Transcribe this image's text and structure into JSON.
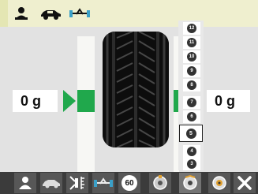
{
  "top_bar": {
    "icons": [
      "person-icon",
      "car-icon",
      "axle-icon"
    ]
  },
  "weights": {
    "left": "0 g",
    "right": "0 g"
  },
  "position_selector": {
    "items": [
      "12",
      "11",
      "10",
      "9",
      "8",
      "7",
      "6",
      "5",
      "4",
      "3"
    ],
    "selected": "5"
  },
  "toolbar": {
    "buttons": [
      {
        "icon": "person-icon"
      },
      {
        "icon": "car-icon"
      },
      {
        "icon": "rim-measure-icon"
      },
      {
        "icon": "axle-icon"
      },
      {
        "label": "60",
        "icon": "speed-badge-icon"
      },
      {
        "icon": "wheel-weight-icon"
      },
      {
        "icon": "wheel-spin-icon"
      },
      {
        "icon": "wheel-hub-icon"
      },
      {
        "icon": "close-icon"
      }
    ]
  },
  "colors": {
    "accent_green": "#20a84c",
    "top_bar": "#efefcf",
    "toolbar": "#3b3b3b"
  }
}
